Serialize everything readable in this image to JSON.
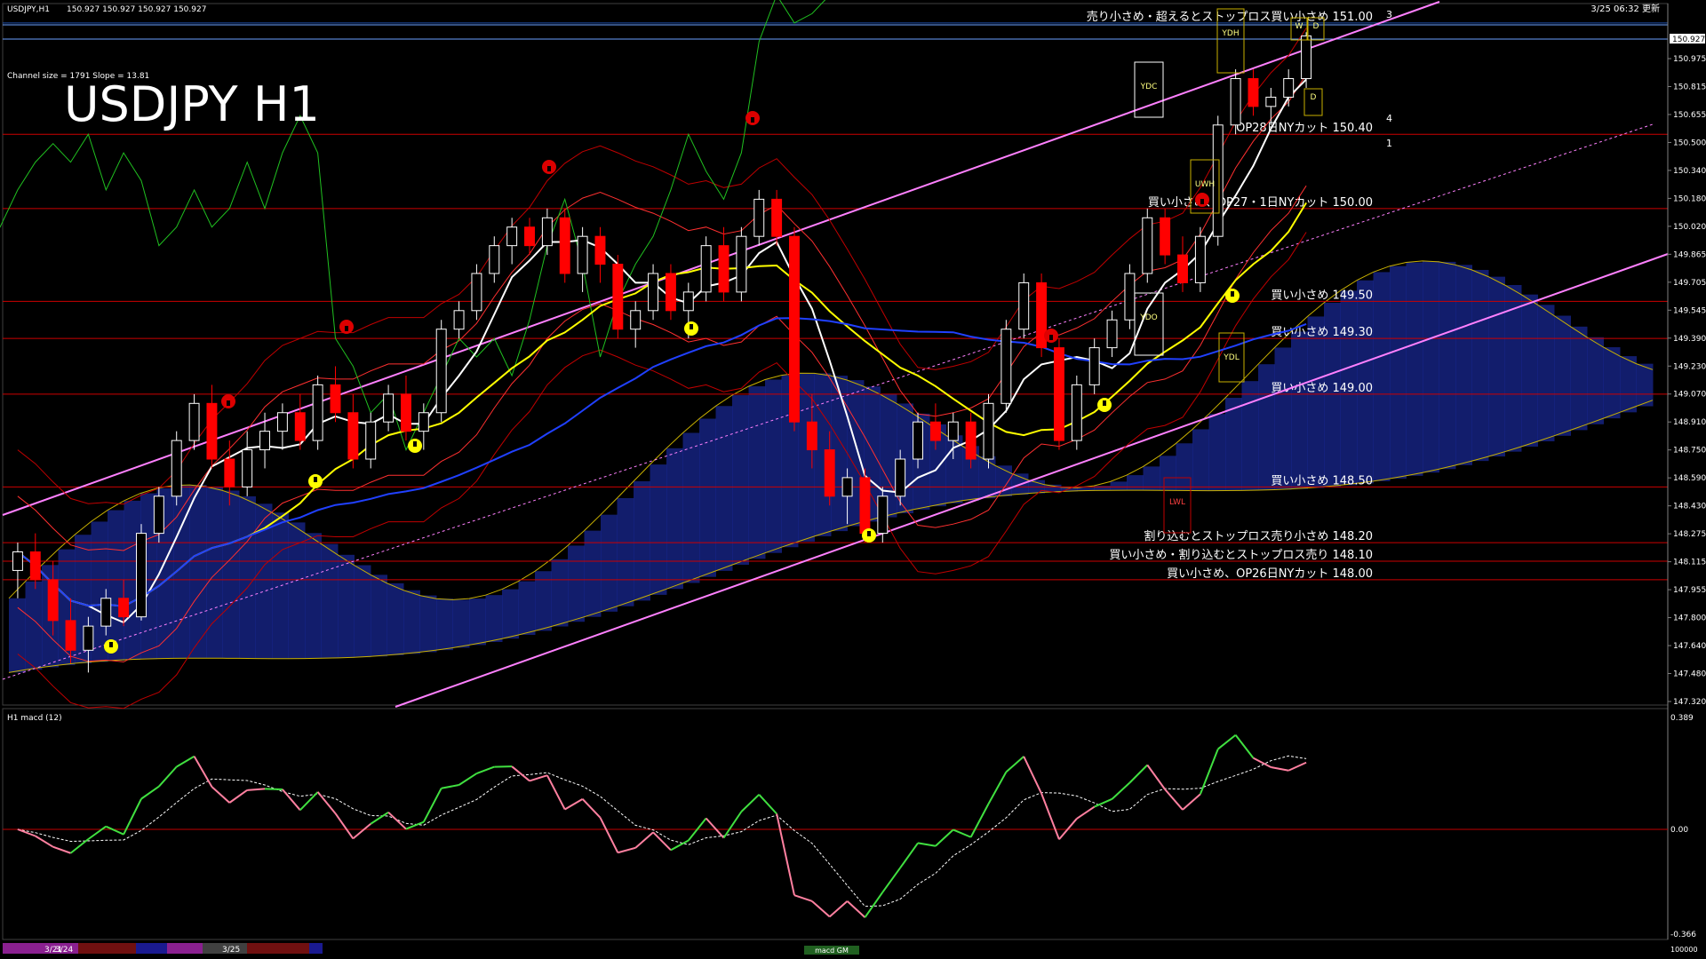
{
  "header": {
    "symbol_info": "USDJPY,H1",
    "ohlc": "150.927 150.927 150.927 150.927",
    "updated": "3/25 06:32 更新",
    "channel_info": "Channel size = 1791 Slope = 13.81",
    "big_title": "USDJPY H1"
  },
  "price_axis": {
    "labels": [
      "150.975",
      "150.815",
      "150.655",
      "150.500",
      "150.340",
      "150.180",
      "150.020",
      "149.865",
      "149.705",
      "149.545",
      "149.390",
      "149.230",
      "149.070",
      "148.910",
      "148.750",
      "148.590",
      "148.430",
      "148.275",
      "148.115",
      "147.955",
      "147.800",
      "147.640",
      "147.480",
      "147.320"
    ],
    "current_price": "150.927"
  },
  "levels": [
    {
      "price": 151.0,
      "text": "売り小さめ・超えるとストップロス買い小さめ 151.00",
      "color": "#1e4ea8"
    },
    {
      "price": 150.4,
      "text": "OP28日NYカット 150.40",
      "color": "#cc0000"
    },
    {
      "price": 150.0,
      "text": "買い小さめ、OP27・1日NYカット 150.00",
      "color": "#cc0000"
    },
    {
      "price": 149.5,
      "text": "買い小さめ 149.50",
      "color": "#cc0000"
    },
    {
      "price": 149.3,
      "text": "買い小さめ 149.30",
      "color": "#cc0000"
    },
    {
      "price": 149.0,
      "text": "買い小さめ 149.00",
      "color": "#cc0000"
    },
    {
      "price": 148.5,
      "text": "買い小さめ 148.50",
      "color": "#cc0000"
    },
    {
      "price": 148.2,
      "text": "割り込むとストップロス売り小さめ 148.20",
      "color": "#cc0000"
    },
    {
      "price": 148.1,
      "text": "買い小さめ・割り込むとストップロス売り 148.10",
      "color": "#cc0000"
    },
    {
      "price": 148.0,
      "text": "買い小さめ、OP26日NYカット 148.00",
      "color": "#cc0000"
    }
  ],
  "box_labels": [
    "YDC",
    "YDO",
    "YDH",
    "YDL",
    "UWH",
    "LWL",
    "W",
    "D",
    "D"
  ],
  "side_numbers": [
    "3",
    "4",
    "1"
  ],
  "macd": {
    "title": "H1  macd (12)",
    "axis": [
      "0.389",
      "0.00",
      "-0.366"
    ],
    "bottom_label": "100000",
    "tag": "macd  GM"
  },
  "time_axis": [
    "3/21",
    "3/24",
    "3/25"
  ],
  "colors": {
    "bull": "#ffffff",
    "bear": "#ff0000",
    "channel": "#ff80ff",
    "ma_white": "#ffffff",
    "ma_yellow": "#ffff00",
    "ma_blue": "#2040ff",
    "chikou": "#20c020",
    "cloud_red": "#b05020",
    "cloud_blue": "#1a2a9a",
    "macd_up": "#40e040",
    "macd_down": "#ff80a0"
  },
  "chart_data": {
    "type": "candlestick",
    "symbol": "USDJPY",
    "timeframe": "H1",
    "ylim": [
      147.32,
      150.98
    ],
    "candles": [
      [
        148.05,
        148.2,
        147.9,
        148.15
      ],
      [
        148.15,
        148.25,
        147.95,
        148.0
      ],
      [
        148.0,
        148.1,
        147.7,
        147.78
      ],
      [
        147.78,
        147.9,
        147.55,
        147.62
      ],
      [
        147.62,
        147.8,
        147.5,
        147.75
      ],
      [
        147.75,
        147.95,
        147.7,
        147.9
      ],
      [
        147.9,
        148.0,
        147.75,
        147.8
      ],
      [
        147.8,
        148.3,
        147.78,
        148.25
      ],
      [
        148.25,
        148.5,
        148.2,
        148.45
      ],
      [
        148.45,
        148.8,
        148.4,
        148.75
      ],
      [
        148.75,
        149.0,
        148.7,
        148.95
      ],
      [
        148.95,
        149.05,
        148.6,
        148.65
      ],
      [
        148.65,
        148.75,
        148.4,
        148.5
      ],
      [
        148.5,
        148.8,
        148.45,
        148.7
      ],
      [
        148.7,
        148.9,
        148.6,
        148.8
      ],
      [
        148.8,
        148.95,
        148.7,
        148.9
      ],
      [
        148.9,
        149.0,
        148.7,
        148.75
      ],
      [
        148.75,
        149.1,
        148.7,
        149.05
      ],
      [
        149.05,
        149.15,
        148.85,
        148.9
      ],
      [
        148.9,
        149.0,
        148.6,
        148.65
      ],
      [
        148.65,
        148.9,
        148.6,
        148.85
      ],
      [
        148.85,
        149.05,
        148.8,
        149.0
      ],
      [
        149.0,
        149.1,
        148.75,
        148.8
      ],
      [
        148.8,
        148.95,
        148.7,
        148.9
      ],
      [
        148.9,
        149.4,
        148.85,
        149.35
      ],
      [
        149.35,
        149.5,
        149.3,
        149.45
      ],
      [
        149.45,
        149.7,
        149.4,
        149.65
      ],
      [
        149.65,
        149.85,
        149.6,
        149.8
      ],
      [
        149.8,
        149.95,
        149.7,
        149.9
      ],
      [
        149.9,
        149.95,
        149.75,
        149.8
      ],
      [
        149.8,
        150.0,
        149.75,
        149.95
      ],
      [
        149.95,
        150.0,
        149.6,
        149.65
      ],
      [
        149.65,
        149.9,
        149.55,
        149.85
      ],
      [
        149.85,
        149.9,
        149.6,
        149.7
      ],
      [
        149.7,
        149.75,
        149.3,
        149.35
      ],
      [
        149.35,
        149.5,
        149.25,
        149.45
      ],
      [
        149.45,
        149.7,
        149.4,
        149.65
      ],
      [
        149.65,
        149.7,
        149.4,
        149.45
      ],
      [
        149.45,
        149.6,
        149.3,
        149.55
      ],
      [
        149.55,
        149.85,
        149.5,
        149.8
      ],
      [
        149.8,
        149.9,
        149.5,
        149.55
      ],
      [
        149.55,
        149.9,
        149.5,
        149.85
      ],
      [
        149.85,
        150.1,
        149.8,
        150.05
      ],
      [
        150.05,
        150.1,
        149.8,
        149.85
      ],
      [
        149.85,
        149.9,
        148.8,
        148.85
      ],
      [
        148.85,
        149.0,
        148.6,
        148.7
      ],
      [
        148.7,
        148.8,
        148.4,
        148.45
      ],
      [
        148.45,
        148.6,
        148.3,
        148.55
      ],
      [
        148.55,
        148.6,
        148.2,
        148.25
      ],
      [
        148.25,
        148.5,
        148.2,
        148.45
      ],
      [
        148.45,
        148.7,
        148.4,
        148.65
      ],
      [
        148.65,
        148.9,
        148.6,
        148.85
      ],
      [
        148.85,
        148.95,
        148.7,
        148.75
      ],
      [
        148.75,
        148.9,
        148.65,
        148.85
      ],
      [
        148.85,
        148.9,
        148.6,
        148.65
      ],
      [
        148.65,
        149.0,
        148.6,
        148.95
      ],
      [
        148.95,
        149.4,
        148.9,
        149.35
      ],
      [
        149.35,
        149.65,
        149.3,
        149.6
      ],
      [
        149.6,
        149.65,
        149.2,
        149.25
      ],
      [
        149.25,
        149.3,
        148.7,
        148.75
      ],
      [
        148.75,
        149.1,
        148.7,
        149.05
      ],
      [
        149.05,
        149.3,
        149.0,
        149.25
      ],
      [
        149.25,
        149.45,
        149.2,
        149.4
      ],
      [
        149.4,
        149.7,
        149.35,
        149.65
      ],
      [
        149.65,
        150.0,
        149.6,
        149.95
      ],
      [
        149.95,
        150.0,
        149.7,
        149.75
      ],
      [
        149.75,
        149.85,
        149.55,
        149.6
      ],
      [
        149.6,
        149.9,
        149.55,
        149.85
      ],
      [
        149.85,
        150.5,
        149.8,
        150.45
      ],
      [
        150.45,
        150.75,
        150.4,
        150.7
      ],
      [
        150.7,
        150.75,
        150.5,
        150.55
      ],
      [
        150.55,
        150.65,
        150.45,
        150.6
      ],
      [
        150.6,
        150.75,
        150.55,
        150.7
      ],
      [
        150.7,
        150.95,
        150.65,
        150.93
      ]
    ]
  }
}
